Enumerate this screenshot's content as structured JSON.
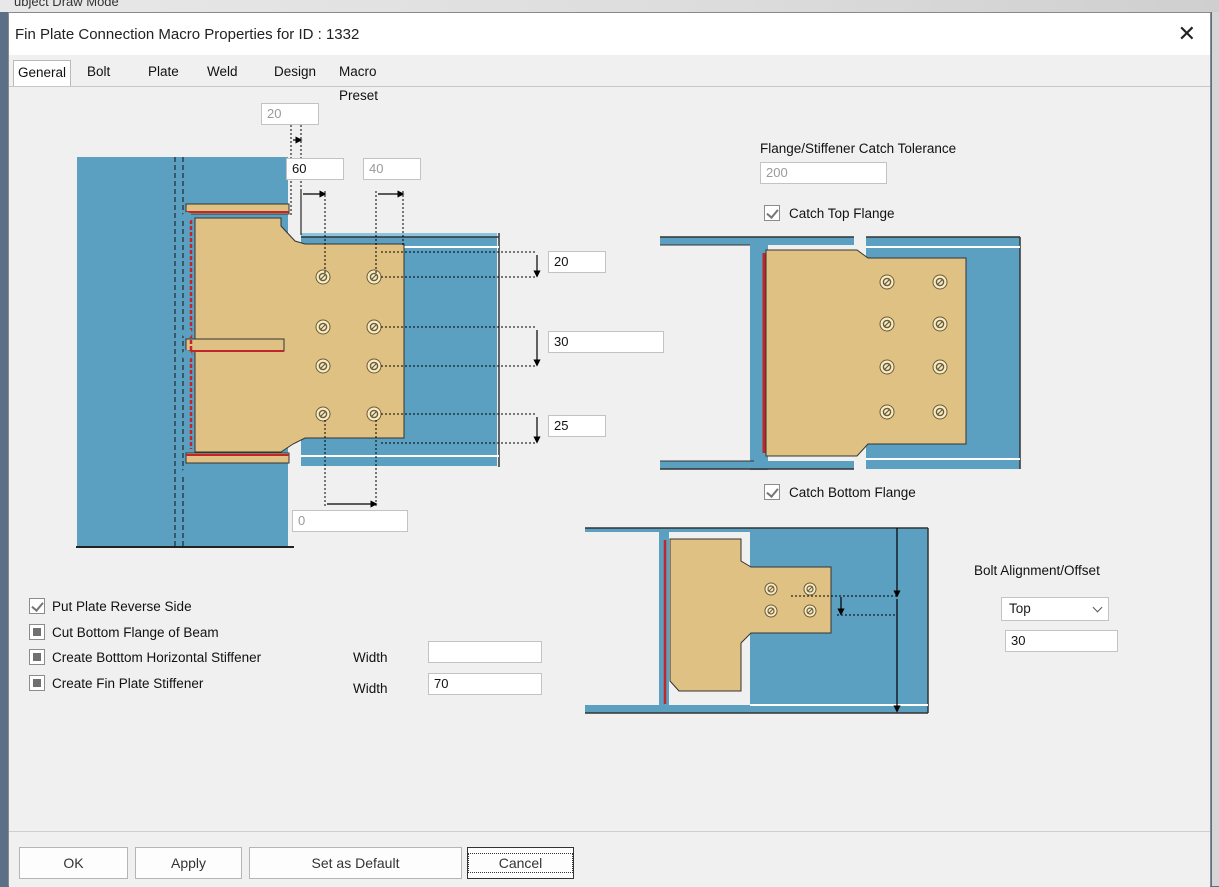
{
  "background": {
    "fragment_text": "ubject Draw Mode"
  },
  "dialog": {
    "title": "Fin Plate Connection Macro Properties for ID : 1332",
    "close_glyph": "✕"
  },
  "tabs": [
    {
      "label": "General",
      "active": true
    },
    {
      "label": "Bolt"
    },
    {
      "label": "Plate"
    },
    {
      "label": "Weld"
    },
    {
      "label": "Design"
    },
    {
      "label": "Macro Preset"
    }
  ],
  "main_figure": {
    "top_clearance": "20",
    "plate_edge_distance": "60",
    "bolt_gauge": "40",
    "top_edge_distance": "20",
    "bolt_pitch": "30",
    "bottom_edge_distance": "25",
    "plate_bottom_cut": "0"
  },
  "flange_catch": {
    "tolerance_label": "Flange/Stiffener Catch Tolerance",
    "tolerance_value": "200",
    "catch_top_label": "Catch Top Flange",
    "catch_top_checked": true,
    "catch_bottom_label": "Catch Bottom Flange",
    "catch_bottom_checked": true
  },
  "bolt_alignment": {
    "label": "Bolt Alignment/Offset",
    "selected": "Top",
    "offset_value": "30"
  },
  "options": {
    "reverse_side_label": "Put Plate Reverse Side",
    "cut_bottom_flange_label": "Cut Bottom Flange of Beam",
    "bottom_stiffener_label": "Create Botttom Horizontal Stiffener",
    "fin_plate_stiffener_label": "Create Fin Plate Stiffener",
    "width_label_1": "Width",
    "width_value_1": "",
    "width_label_2": "Width",
    "width_value_2": "70"
  },
  "buttons": {
    "ok": "OK",
    "apply": "Apply",
    "set_default": "Set as Default",
    "cancel": "Cancel"
  },
  "colors": {
    "steel": "#5b9fc1",
    "plate": "#dfc184",
    "weld": "#c0262c",
    "dialog_bg": "#f0f0f0"
  }
}
